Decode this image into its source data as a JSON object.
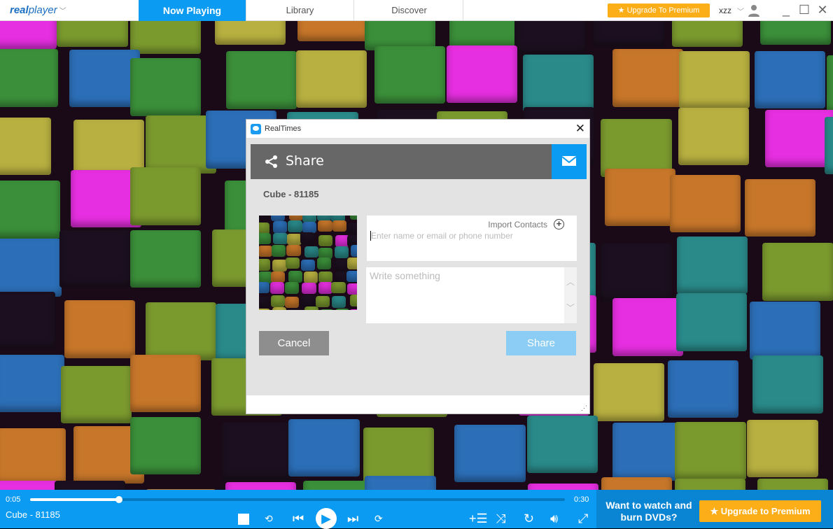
{
  "app": {
    "logo_text": "realplayer"
  },
  "tabs": [
    {
      "label": "Now Playing",
      "active": true
    },
    {
      "label": "Library"
    },
    {
      "label": "Discover"
    }
  ],
  "header": {
    "upgrade_label": "★ Upgrade To Premium",
    "user": "xzz",
    "accent": "#0c9bf2",
    "premium_color": "#fbae17"
  },
  "dialog": {
    "title": "RealTimes",
    "share_label": "Share",
    "media_title": "Cube - 81185",
    "import_contacts": "Import Contacts",
    "to_placeholder": "Enter name or email or phone number",
    "message_placeholder": "Write something",
    "cancel_label": "Cancel",
    "share_button": "Share"
  },
  "player": {
    "current_time": "0:05",
    "duration": "0:30",
    "progress_fraction": 0.1667,
    "now_playing": "Cube - 81185"
  },
  "promo": {
    "text": "Want to watch and burn DVDs?",
    "upgrade_label": "★ Upgrade to Premium"
  }
}
